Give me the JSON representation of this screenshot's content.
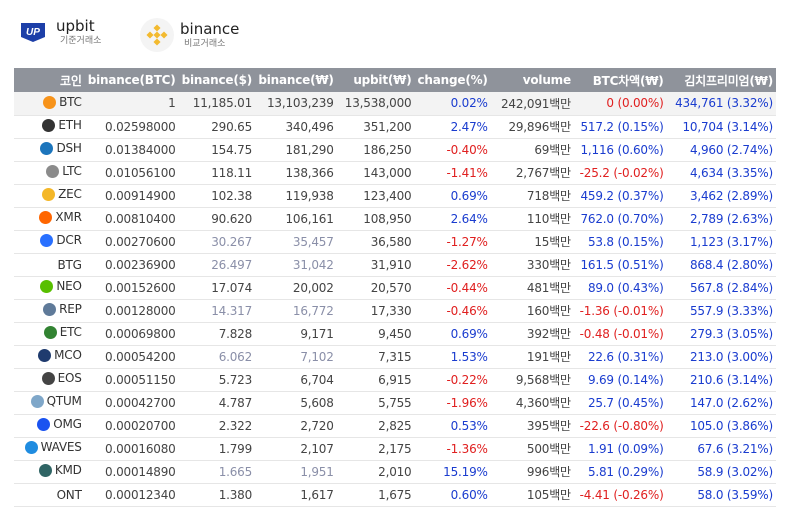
{
  "header": {
    "upbit": {
      "name": "upbit",
      "sub": "기준거래소"
    },
    "binance": {
      "name": "binance",
      "sub": "비교거래소"
    }
  },
  "columns": [
    "코인",
    "binance(BTC)",
    "binance($)",
    "binance(₩)",
    "upbit(₩)",
    "change(%)",
    "volume",
    "BTC차액(₩)",
    "김치프리미엄(₩)"
  ],
  "colors": {
    "positive": "#1a3ccf",
    "negative": "#e02020",
    "dim": "#8a8fa8",
    "header_bg": "#8f939b"
  },
  "rows": [
    {
      "coin": "BTC",
      "icon": "bitcoin-icon",
      "icolor": "#f7931a",
      "btc": "1",
      "usd": "11,185.01",
      "krw": "13,103,239",
      "upbit": "13,538,000",
      "change": "0.02%",
      "volume": "242,091백만",
      "diff": "0 (0.00%)",
      "prem": "434,761 (3.32%)",
      "chg_sign": "pos",
      "diff_sign": "neg",
      "dim": false
    },
    {
      "coin": "ETH",
      "icon": "ethereum-icon",
      "icolor": "#333333",
      "btc": "0.02598000",
      "usd": "290.65",
      "krw": "340,496",
      "upbit": "351,200",
      "change": "2.47%",
      "volume": "29,896백만",
      "diff": "517.2 (0.15%)",
      "prem": "10,704 (3.14%)",
      "chg_sign": "pos",
      "diff_sign": "pos",
      "dim": false
    },
    {
      "coin": "DSH",
      "icon": "dash-icon",
      "icolor": "#1c75bc",
      "btc": "0.01384000",
      "usd": "154.75",
      "krw": "181,290",
      "upbit": "186,250",
      "change": "-0.40%",
      "volume": "69백만",
      "diff": "1,116 (0.60%)",
      "prem": "4,960 (2.74%)",
      "chg_sign": "neg",
      "diff_sign": "pos",
      "dim": false
    },
    {
      "coin": "LTC",
      "icon": "litecoin-icon",
      "icolor": "#8b8b8b",
      "btc": "0.01056100",
      "usd": "118.11",
      "krw": "138,366",
      "upbit": "143,000",
      "change": "-1.41%",
      "volume": "2,767백만",
      "diff": "-25.2 (-0.02%)",
      "prem": "4,634 (3.35%)",
      "chg_sign": "neg",
      "diff_sign": "neg",
      "dim": false
    },
    {
      "coin": "ZEC",
      "icon": "zcash-icon",
      "icolor": "#f4b728",
      "btc": "0.00914900",
      "usd": "102.38",
      "krw": "119,938",
      "upbit": "123,400",
      "change": "0.69%",
      "volume": "718백만",
      "diff": "459.2 (0.37%)",
      "prem": "3,462 (2.89%)",
      "chg_sign": "pos",
      "diff_sign": "pos",
      "dim": false
    },
    {
      "coin": "XMR",
      "icon": "monero-icon",
      "icolor": "#ff6600",
      "btc": "0.00810400",
      "usd": "90.620",
      "krw": "106,161",
      "upbit": "108,950",
      "change": "2.64%",
      "volume": "110백만",
      "diff": "762.0 (0.70%)",
      "prem": "2,789 (2.63%)",
      "chg_sign": "pos",
      "diff_sign": "pos",
      "dim": false
    },
    {
      "coin": "DCR",
      "icon": "decred-icon",
      "icolor": "#2970ff",
      "btc": "0.00270600",
      "usd": "30.267",
      "krw": "35,457",
      "upbit": "36,580",
      "change": "-1.27%",
      "volume": "15백만",
      "diff": "53.8 (0.15%)",
      "prem": "1,123 (3.17%)",
      "chg_sign": "neg",
      "diff_sign": "pos",
      "dim": true
    },
    {
      "coin": "BTG",
      "icon": "",
      "icolor": "",
      "btc": "0.00236900",
      "usd": "26.497",
      "krw": "31,042",
      "upbit": "31,910",
      "change": "-2.62%",
      "volume": "330백만",
      "diff": "161.5 (0.51%)",
      "prem": "868.4 (2.80%)",
      "chg_sign": "neg",
      "diff_sign": "pos",
      "dim": true
    },
    {
      "coin": "NEO",
      "icon": "neo-icon",
      "icolor": "#58bf00",
      "btc": "0.00152600",
      "usd": "17.074",
      "krw": "20,002",
      "upbit": "20,570",
      "change": "-0.44%",
      "volume": "481백만",
      "diff": "89.0 (0.43%)",
      "prem": "567.8 (2.84%)",
      "chg_sign": "neg",
      "diff_sign": "pos",
      "dim": false
    },
    {
      "coin": "REP",
      "icon": "augur-icon",
      "icolor": "#5f7a99",
      "btc": "0.00128000",
      "usd": "14.317",
      "krw": "16,772",
      "upbit": "17,330",
      "change": "-0.46%",
      "volume": "160백만",
      "diff": "-1.36 (-0.01%)",
      "prem": "557.9 (3.33%)",
      "chg_sign": "neg",
      "diff_sign": "neg",
      "dim": true
    },
    {
      "coin": "ETC",
      "icon": "ethereum-classic-icon",
      "icolor": "#328332",
      "btc": "0.00069800",
      "usd": "7.828",
      "krw": "9,171",
      "upbit": "9,450",
      "change": "0.69%",
      "volume": "392백만",
      "diff": "-0.48 (-0.01%)",
      "prem": "279.3 (3.05%)",
      "chg_sign": "pos",
      "diff_sign": "neg",
      "dim": false
    },
    {
      "coin": "MCO",
      "icon": "monaco-icon",
      "icolor": "#1f3b6e",
      "btc": "0.00054200",
      "usd": "6.062",
      "krw": "7,102",
      "upbit": "7,315",
      "change": "1.53%",
      "volume": "191백만",
      "diff": "22.6 (0.31%)",
      "prem": "213.0 (3.00%)",
      "chg_sign": "pos",
      "diff_sign": "pos",
      "dim": true
    },
    {
      "coin": "EOS",
      "icon": "eos-icon",
      "icolor": "#444444",
      "btc": "0.00051150",
      "usd": "5.723",
      "krw": "6,704",
      "upbit": "6,915",
      "change": "-0.22%",
      "volume": "9,568백만",
      "diff": "9.69 (0.14%)",
      "prem": "210.6 (3.14%)",
      "chg_sign": "neg",
      "diff_sign": "pos",
      "dim": false
    },
    {
      "coin": "QTUM",
      "icon": "qtum-icon",
      "icolor": "#7fa7c9",
      "btc": "0.00042700",
      "usd": "4.787",
      "krw": "5,608",
      "upbit": "5,755",
      "change": "-1.96%",
      "volume": "4,360백만",
      "diff": "25.7 (0.45%)",
      "prem": "147.0 (2.62%)",
      "chg_sign": "neg",
      "diff_sign": "pos",
      "dim": false
    },
    {
      "coin": "OMG",
      "icon": "omisego-icon",
      "icolor": "#1a53f0",
      "btc": "0.00020700",
      "usd": "2.322",
      "krw": "2,720",
      "upbit": "2,825",
      "change": "0.53%",
      "volume": "395백만",
      "diff": "-22.6 (-0.80%)",
      "prem": "105.0 (3.86%)",
      "chg_sign": "pos",
      "diff_sign": "neg",
      "dim": false
    },
    {
      "coin": "WAVES",
      "icon": "waves-icon",
      "icolor": "#1f8ce0",
      "btc": "0.00016080",
      "usd": "1.799",
      "krw": "2,107",
      "upbit": "2,175",
      "change": "-1.36%",
      "volume": "500백만",
      "diff": "1.91 (0.09%)",
      "prem": "67.6 (3.21%)",
      "chg_sign": "neg",
      "diff_sign": "pos",
      "dim": false
    },
    {
      "coin": "KMD",
      "icon": "komodo-icon",
      "icolor": "#306565",
      "btc": "0.00014890",
      "usd": "1.665",
      "krw": "1,951",
      "upbit": "2,010",
      "change": "15.19%",
      "volume": "996백만",
      "diff": "5.81 (0.29%)",
      "prem": "58.9 (3.02%)",
      "chg_sign": "pos",
      "diff_sign": "pos",
      "dim": true
    },
    {
      "coin": "ONT",
      "icon": "",
      "icolor": "",
      "btc": "0.00012340",
      "usd": "1.380",
      "krw": "1,617",
      "upbit": "1,675",
      "change": "0.60%",
      "volume": "105백만",
      "diff": "-4.41 (-0.26%)",
      "prem": "58.0 (3.59%)",
      "chg_sign": "pos",
      "diff_sign": "neg",
      "dim": false
    }
  ]
}
